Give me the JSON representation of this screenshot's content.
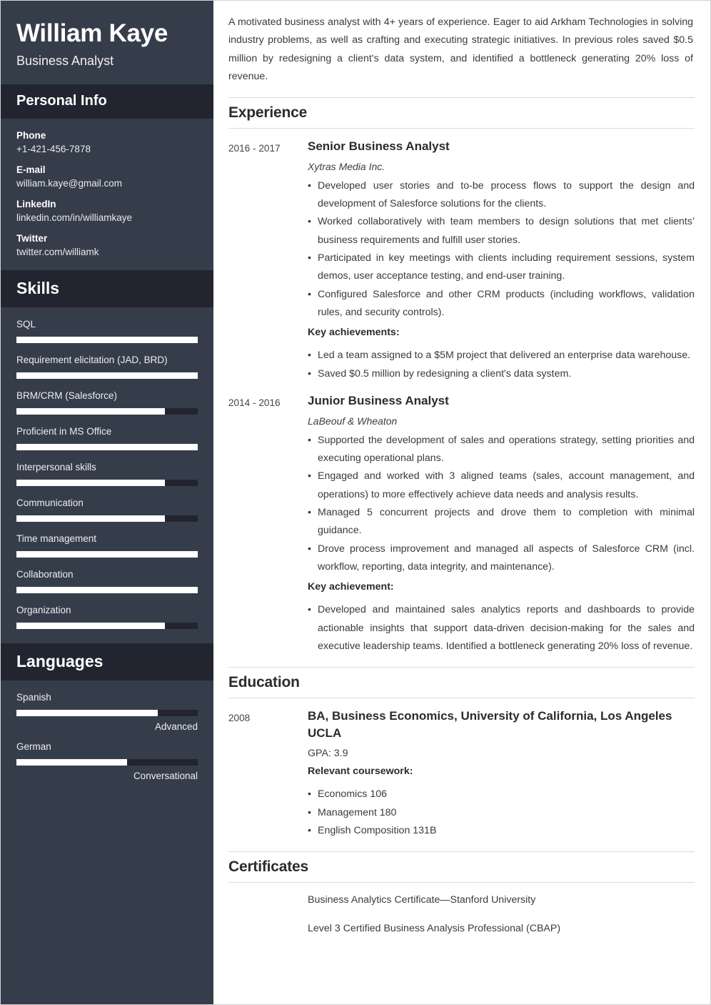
{
  "sidebar": {
    "full_name": "William Kaye",
    "job_title": "Business Analyst",
    "personal_info": {
      "heading": "Personal Info",
      "items": [
        {
          "label": "Phone",
          "value": "+1-421-456-7878"
        },
        {
          "label": "E-mail",
          "value": "william.kaye@gmail.com"
        },
        {
          "label": "LinkedIn",
          "value": "linkedin.com/in/williamkaye"
        },
        {
          "label": "Twitter",
          "value": "twitter.com/williamk"
        }
      ]
    },
    "skills": {
      "heading": "Skills",
      "items": [
        {
          "label": "SQL",
          "level": 100
        },
        {
          "label": "Requirement elicitation (JAD, BRD)",
          "level": 100
        },
        {
          "label": "BRM/CRM (Salesforce)",
          "level": 82
        },
        {
          "label": "Proficient in MS Office",
          "level": 100
        },
        {
          "label": "Interpersonal skills",
          "level": 82
        },
        {
          "label": "Communication",
          "level": 82
        },
        {
          "label": "Time management",
          "level": 100
        },
        {
          "label": "Collaboration",
          "level": 100
        },
        {
          "label": "Organization",
          "level": 82
        }
      ]
    },
    "languages": {
      "heading": "Languages",
      "items": [
        {
          "label": "Spanish",
          "level": 78,
          "proficiency": "Advanced"
        },
        {
          "label": "German",
          "level": 61,
          "proficiency": "Conversational"
        }
      ]
    }
  },
  "main": {
    "summary": "A motivated business analyst with 4+ years of experience. Eager to aid Arkham Technologies in solving industry problems, as well as crafting and executing strategic initiatives. In previous roles saved $0.5 million by redesigning a client's data system, and identified a bottleneck generating 20% loss of revenue.",
    "experience": {
      "heading": "Experience",
      "entries": [
        {
          "date": "2016 - 2017",
          "title": "Senior Business Analyst",
          "company": "Xytras Media Inc.",
          "bullets": [
            "Developed user stories and to-be process flows to support the design and development of Salesforce solutions for the clients.",
            "Worked collaboratively with team members to design solutions that met clients’ business requirements and fulfill user stories.",
            "Participated in key meetings with clients including requirement sessions, system demos, user acceptance testing, and end-user training.",
            "Configured Salesforce and other CRM products (including workflows, validation rules, and security controls)."
          ],
          "achievements_label": "Key achievements:",
          "achievements": [
            "Led a team assigned to a $5M project that delivered an enterprise data warehouse.",
            "Saved $0.5 million by redesigning a client's data system."
          ]
        },
        {
          "date": "2014 - 2016",
          "title": "Junior Business Analyst",
          "company": "LaBeouf & Wheaton",
          "bullets": [
            "Supported the development of sales and operations strategy, setting priorities and executing operational plans.",
            "Engaged and worked with 3 aligned teams (sales, account management, and operations) to more effectively achieve data needs and analysis results.",
            "Managed 5 concurrent projects and drove them to completion with minimal guidance.",
            "Drove process improvement and managed all aspects of Salesforce CRM (incl. workflow, reporting, data integrity, and maintenance)."
          ],
          "achievements_label": "Key achievement:",
          "achievements": [
            "Developed and maintained sales analytics reports and dashboards to provide actionable insights that support data-driven decision-making for the sales and executive leadership teams. Identified a bottleneck generating 20% loss of revenue."
          ]
        }
      ]
    },
    "education": {
      "heading": "Education",
      "entries": [
        {
          "date": "2008",
          "title": "BA, Business Economics, University of California, Los Angeles UCLA",
          "gpa": "GPA: 3.9",
          "coursework_label": "Relevant coursework:",
          "coursework": [
            "Economics 106",
            "Management 180",
            "English Composition 131B"
          ]
        }
      ]
    },
    "certificates": {
      "heading": "Certificates",
      "items": [
        "Business Analytics Certificate—Stanford University",
        "Level 3 Certified Business Analysis Professional (CBAP)"
      ]
    }
  }
}
